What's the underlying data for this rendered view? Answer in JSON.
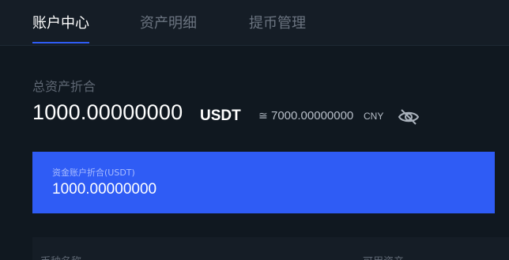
{
  "tabs": [
    {
      "label": "账户中心",
      "active": true
    },
    {
      "label": "资产明细",
      "active": false
    },
    {
      "label": "提币管理",
      "active": false
    }
  ],
  "summary": {
    "label": "总资产折合",
    "value": "1000.00000000",
    "unit": "USDT",
    "approx_symbol": "≅",
    "approx_value": "7000.00000000",
    "approx_unit": "CNY",
    "toggle_icon": "eye-slash-icon"
  },
  "account_card": {
    "label": "资金账户折合(USDT)",
    "value": "1000.00000000"
  },
  "table": {
    "columns": [
      "币种名称",
      "可用资产"
    ]
  },
  "colors": {
    "background": "#101820",
    "panel": "#151d26",
    "accent": "#2f5cf5"
  }
}
